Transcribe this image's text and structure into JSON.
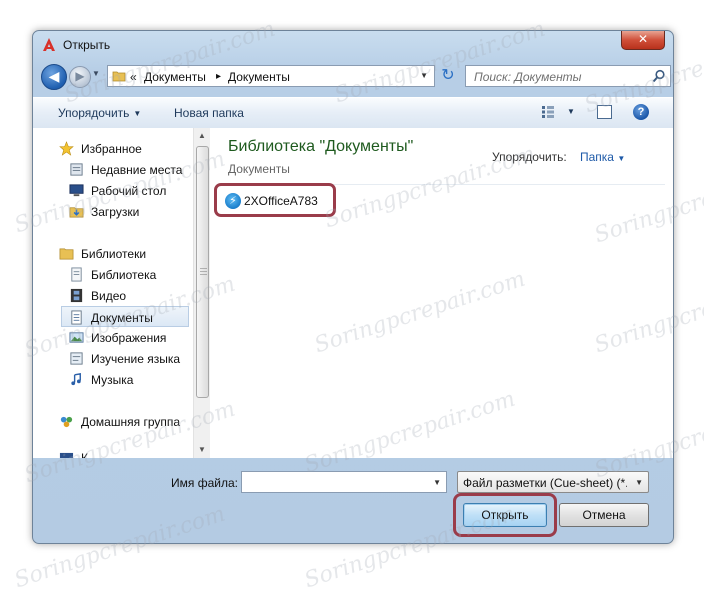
{
  "window": {
    "title": "Открыть",
    "close_glyph": "✕"
  },
  "navbar": {
    "back_glyph": "◀",
    "forward_glyph": "▶",
    "breadcrumb_prefix": "«",
    "breadcrumb": [
      "Документы",
      "Документы"
    ],
    "separator": "▸",
    "refresh_glyph": "↻",
    "search_placeholder": "Поиск: Документы"
  },
  "toolbar": {
    "organize": "Упорядочить",
    "new_folder": "Новая папка",
    "help": "?"
  },
  "sidebar": {
    "items": [
      {
        "label": "Избранное",
        "icon": "star-icon"
      },
      {
        "label": "Недавние места",
        "icon": "recent-places-icon"
      },
      {
        "label": "Рабочий стол",
        "icon": "desktop-icon"
      },
      {
        "label": "Загрузки",
        "icon": "downloads-icon"
      },
      {
        "label": "Библиотеки",
        "icon": "libraries-icon"
      },
      {
        "label": "Библиотека",
        "icon": "library-icon"
      },
      {
        "label": "Видео",
        "icon": "video-icon"
      },
      {
        "label": "Документы",
        "icon": "documents-icon",
        "selected": true
      },
      {
        "label": "Изображения",
        "icon": "images-icon"
      },
      {
        "label": "Изучение языка",
        "icon": "language-icon"
      },
      {
        "label": "Музыка",
        "icon": "music-icon"
      },
      {
        "label": "Домашняя группа",
        "icon": "homegroup-icon"
      },
      {
        "label": "К",
        "icon": "computer-icon"
      }
    ]
  },
  "content": {
    "title": "Библиотека \"Документы\"",
    "subtitle": "Документы",
    "arrange_label": "Упорядочить:",
    "arrange_value": "Папка",
    "files": [
      {
        "name": "2XOfficeA783",
        "icon": "app-file-icon"
      }
    ]
  },
  "bottom": {
    "filename_label": "Имя файла:",
    "filename_value": "",
    "filter": "Файл разметки (Cue-sheet) (*.",
    "open": "Открыть",
    "cancel": "Отмена"
  },
  "watermark": "Soringpcrepair.com",
  "colors": {
    "highlight": "#9a3c4a",
    "library_title": "#1e5a1e",
    "link": "#1e5aa8"
  }
}
